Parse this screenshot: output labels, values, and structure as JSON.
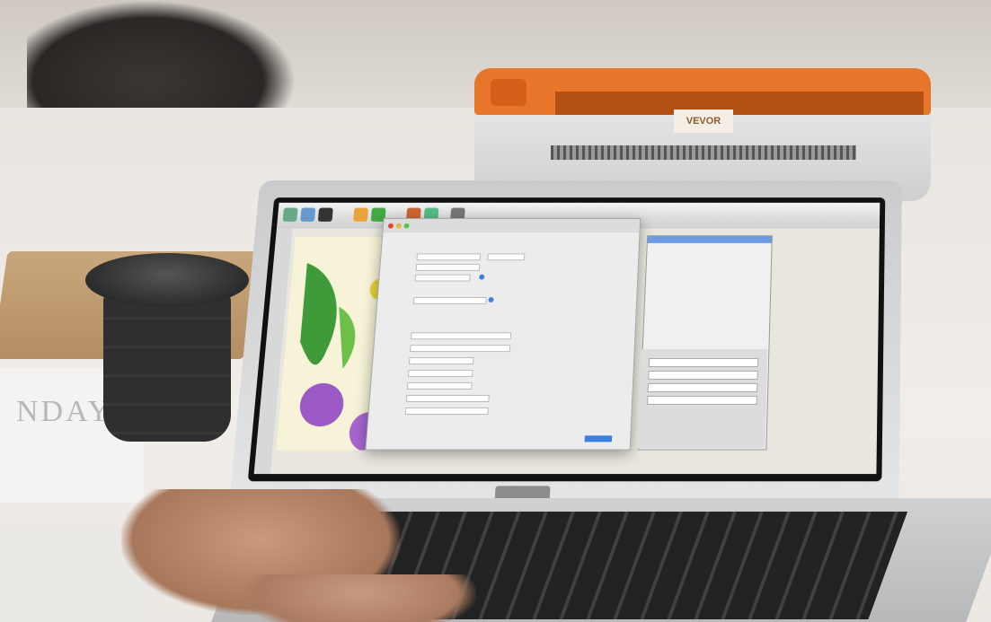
{
  "printer": {
    "brand_label": "VEVOR"
  },
  "colors": {
    "printer_orange": "#e8762a",
    "screen_accent": "#3d7fe0",
    "laptop_silver": "#d7d8d9"
  },
  "icons": [
    "laptop-camera-icon",
    "toolbar-icons",
    "color-dots"
  ]
}
